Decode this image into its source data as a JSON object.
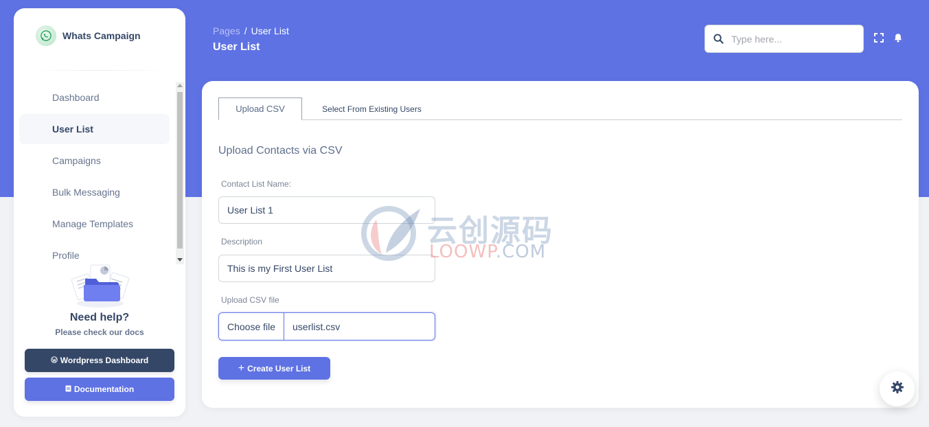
{
  "brand": {
    "name": "Whats Campaign",
    "logo_icon": "whatsapp-icon"
  },
  "sidebar": {
    "items": [
      {
        "label": "Dashboard",
        "active": false
      },
      {
        "label": "User List",
        "active": true
      },
      {
        "label": "Campaigns",
        "active": false
      },
      {
        "label": "Bulk Messaging",
        "active": false
      },
      {
        "label": "Manage Templates",
        "active": false
      },
      {
        "label": "Profile",
        "active": false
      }
    ],
    "help": {
      "title": "Need help?",
      "subtitle": "Please check our docs",
      "illustration_icon": "folder-documents-icon"
    },
    "buttons": {
      "wordpress_label": "Wordpress Dashboard",
      "wordpress_icon": "wordpress-icon",
      "docs_label": "Documentation",
      "docs_icon": "document-icon"
    }
  },
  "header": {
    "breadcrumb": {
      "parent": "Pages",
      "separator": "/",
      "current": "User List"
    },
    "title": "User List",
    "search": {
      "placeholder": "Type here...",
      "value": ""
    },
    "icons": [
      "fullscreen-icon",
      "bell-icon"
    ]
  },
  "main": {
    "tabs": [
      {
        "label": "Upload CSV",
        "active": true
      },
      {
        "label": "Select From Existing Users",
        "active": false
      }
    ],
    "section_title": "Upload Contacts via CSV",
    "form": {
      "list_name_label": "Contact List Name:",
      "list_name_value": "User List 1",
      "description_label": "Description",
      "description_value": "This is my First User List",
      "file_label": "Upload CSV file",
      "file_button": "Choose file",
      "file_name": "userlist.csv",
      "submit_label": "Create User List"
    }
  },
  "watermark": {
    "cn_text": "云创源码",
    "en_red": "LOOWP",
    "en_blue": ".COM"
  },
  "colors": {
    "primary": "#5e72e4",
    "dark": "#344767",
    "muted": "#67748e",
    "background": "#f0f2f5"
  },
  "settings_fab_icon": "gear-icon"
}
